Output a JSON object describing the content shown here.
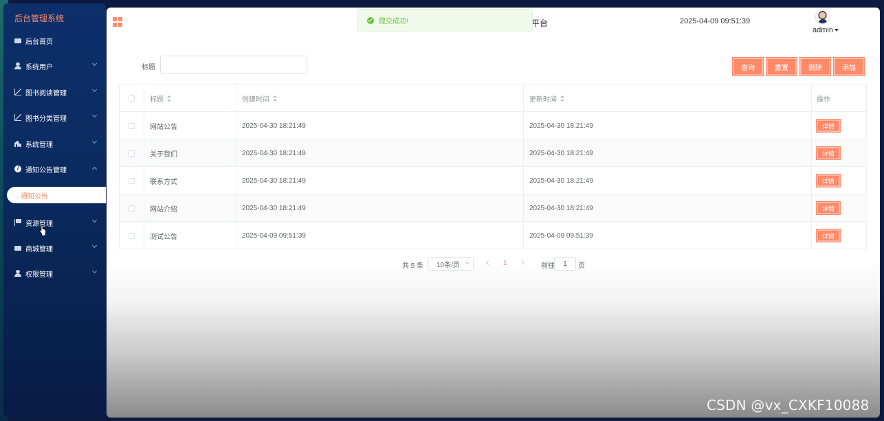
{
  "sidebar": {
    "brand": "后台管理系统",
    "items": [
      {
        "label": "后台首页",
        "icon": "monitor-icon",
        "arrow": false
      },
      {
        "label": "系统用户",
        "icon": "user-icon",
        "arrow": true
      },
      {
        "label": "图书阅读管理",
        "icon": "chart-icon",
        "arrow": true
      },
      {
        "label": "图书分类管理",
        "icon": "chart-icon",
        "arrow": true
      },
      {
        "label": "系统管理",
        "icon": "bar-chart-icon",
        "arrow": true
      },
      {
        "label": "通知公告管理",
        "icon": "info-icon",
        "arrow": true,
        "expanded": true
      },
      {
        "label": "资源管理",
        "icon": "flag-icon",
        "arrow": true
      },
      {
        "label": "商城管理",
        "icon": "monitor-icon",
        "arrow": true
      },
      {
        "label": "权限管理",
        "icon": "user-icon",
        "arrow": true
      }
    ],
    "active_sub_item": "通知公告"
  },
  "header": {
    "title_fragment": "平台",
    "datetime": "2025-04-09 09:51:39",
    "username": "admin"
  },
  "toast": {
    "message": "提交成功!",
    "type": "success"
  },
  "search": {
    "label": "标题",
    "value": ""
  },
  "buttons": {
    "query": "查询",
    "reset": "重置",
    "delete": "删除",
    "add": "添加"
  },
  "table": {
    "columns": [
      "标题",
      "创建时间",
      "更新时间",
      "操作"
    ],
    "rows": [
      {
        "title": "网站公告",
        "created": "2025-04-30 18:21:49",
        "updated": "2025-04-30 18:21:49",
        "action": "详情"
      },
      {
        "title": "关于我们",
        "created": "2025-04-30 18:21:49",
        "updated": "2025-04-30 18:21:49",
        "action": "详情"
      },
      {
        "title": "联系方式",
        "created": "2025-04-30 18:21:49",
        "updated": "2025-04-30 18:21:49",
        "action": "详情"
      },
      {
        "title": "网站介绍",
        "created": "2025-04-30 18:21:49",
        "updated": "2025-04-30 18:21:49",
        "action": "详情"
      },
      {
        "title": "测试公告",
        "created": "2025-04-09 09:51:39",
        "updated": "2025-04-09 09:51:39",
        "action": "详情"
      }
    ]
  },
  "pagination": {
    "total_text": "共 5 条",
    "page_size": "10条/页",
    "current_page": "1",
    "goto_label": "前往",
    "goto_value": "1",
    "page_suffix": "页"
  },
  "watermark": "CSDN @vx_CXKF10088",
  "colors": {
    "accent": "#ff8a6a",
    "sidebar_bg": "#0b2b60",
    "success": "#67c23a"
  }
}
